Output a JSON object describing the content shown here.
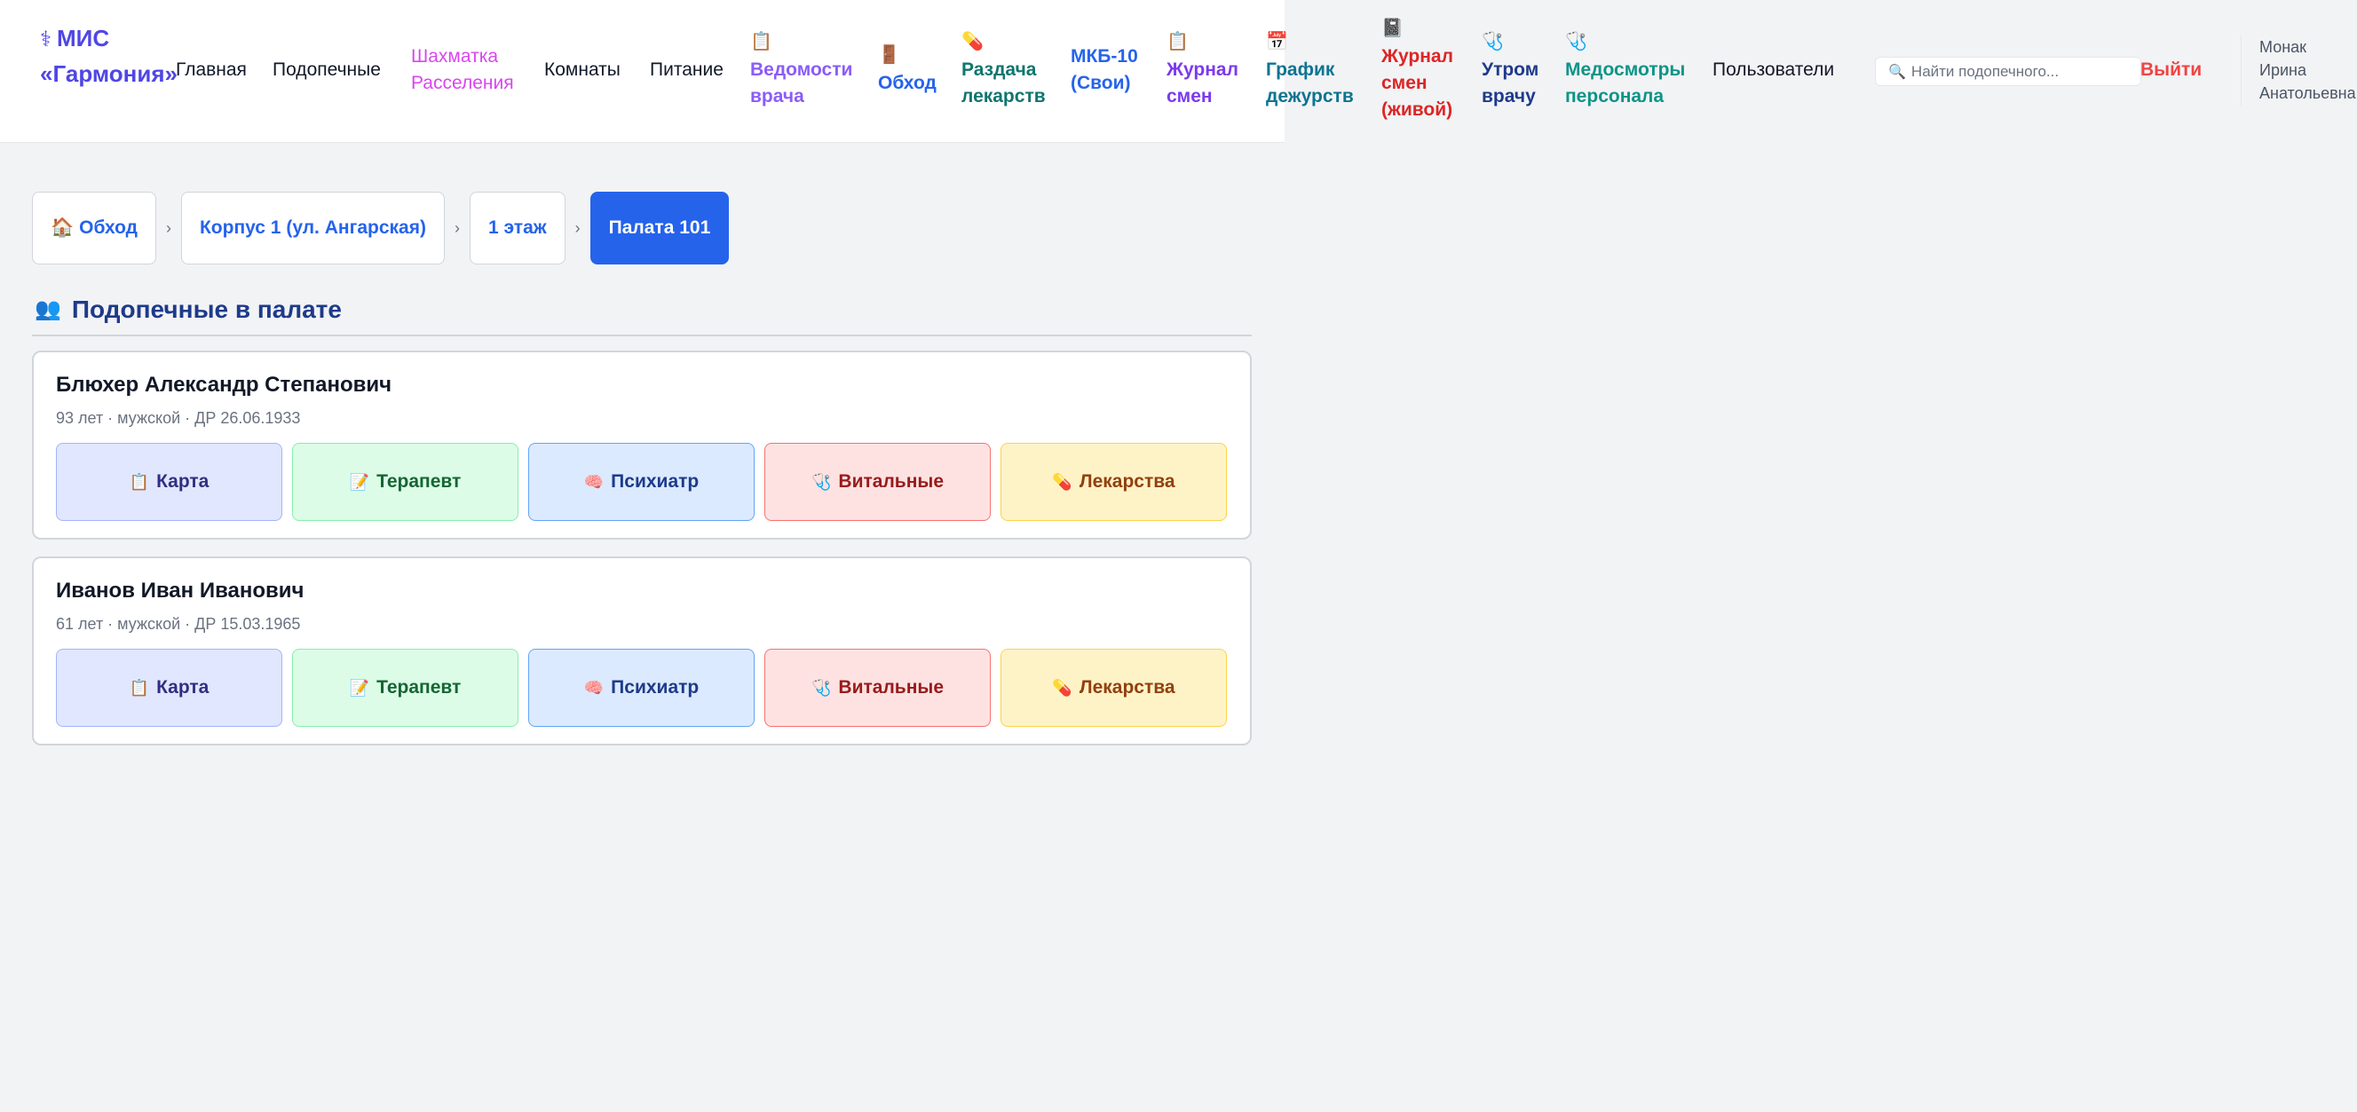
{
  "app": {
    "brand_icon": "⚕",
    "brand_line1": "МИС",
    "brand_line2": "«Гармония»"
  },
  "nav": {
    "home": "Главная",
    "wards": "Подопечные",
    "chess_1": "Шахматка",
    "chess_2": "Расселения",
    "rooms": "Комнаты",
    "food": "Питание",
    "vedomosti_icon": "clipboard-icon",
    "vedomosti_1": "Ведомости",
    "vedomosti_2": "врача",
    "obhod_icon": "door-icon",
    "obhod": "Обход",
    "razdacha_icon": "pill-icon",
    "razdacha_1": "Раздача",
    "razdacha_2": "лекарств",
    "mkb_1": "МКБ-10",
    "mkb_2": "(Свои)",
    "journal_icon": "clipboard-icon",
    "journal_1": "Журнал",
    "journal_2": "смен",
    "grafik_icon": "calendar-icon",
    "grafik_1": "График",
    "grafik_2": "дежурств",
    "live_icon": "book-icon",
    "live_1": "Журнал",
    "live_2": "смен",
    "live_3": "(живой)",
    "utrom_icon": "stethoscope-icon",
    "utrom_1": "Утром",
    "utrom_2": "врачу",
    "medosm_icon": "stethoscope-icon",
    "medosm_1": "Медосмотры",
    "medosm_2": "персонала",
    "users": "Пользователи"
  },
  "search": {
    "icon": "search-icon",
    "placeholder": "Найти подопечного..."
  },
  "logout": "Выйти",
  "user": {
    "line1": "Монак",
    "line2": "Ирина",
    "line3": "Анатольевна"
  },
  "breadcrumbs": [
    {
      "icon": "🏠",
      "label": "Обход"
    },
    {
      "label": "Корпус 1 (ул. Ангарская)"
    },
    {
      "label": "1 этаж"
    },
    {
      "label": "Палата 101"
    }
  ],
  "breadcrumb_separator": "›",
  "section": {
    "icon": "👥",
    "title": "Подопечные в палате"
  },
  "action_labels": {
    "card": "Карта",
    "therapist": "Терапевт",
    "psychiatrist": "Психиатр",
    "vitals": "Витальные",
    "meds": "Лекарства"
  },
  "residents": [
    {
      "name": "Блюхер Александр Степанович",
      "meta": "93 лет · мужской · ДР 26.06.1933"
    },
    {
      "name": "Иванов Иван Иванович",
      "meta": "61 лет · мужской · ДР 15.03.1965"
    }
  ],
  "colors": {
    "brand": "#4f46e5",
    "primary": "#2563eb",
    "danger": "#ef4444"
  }
}
